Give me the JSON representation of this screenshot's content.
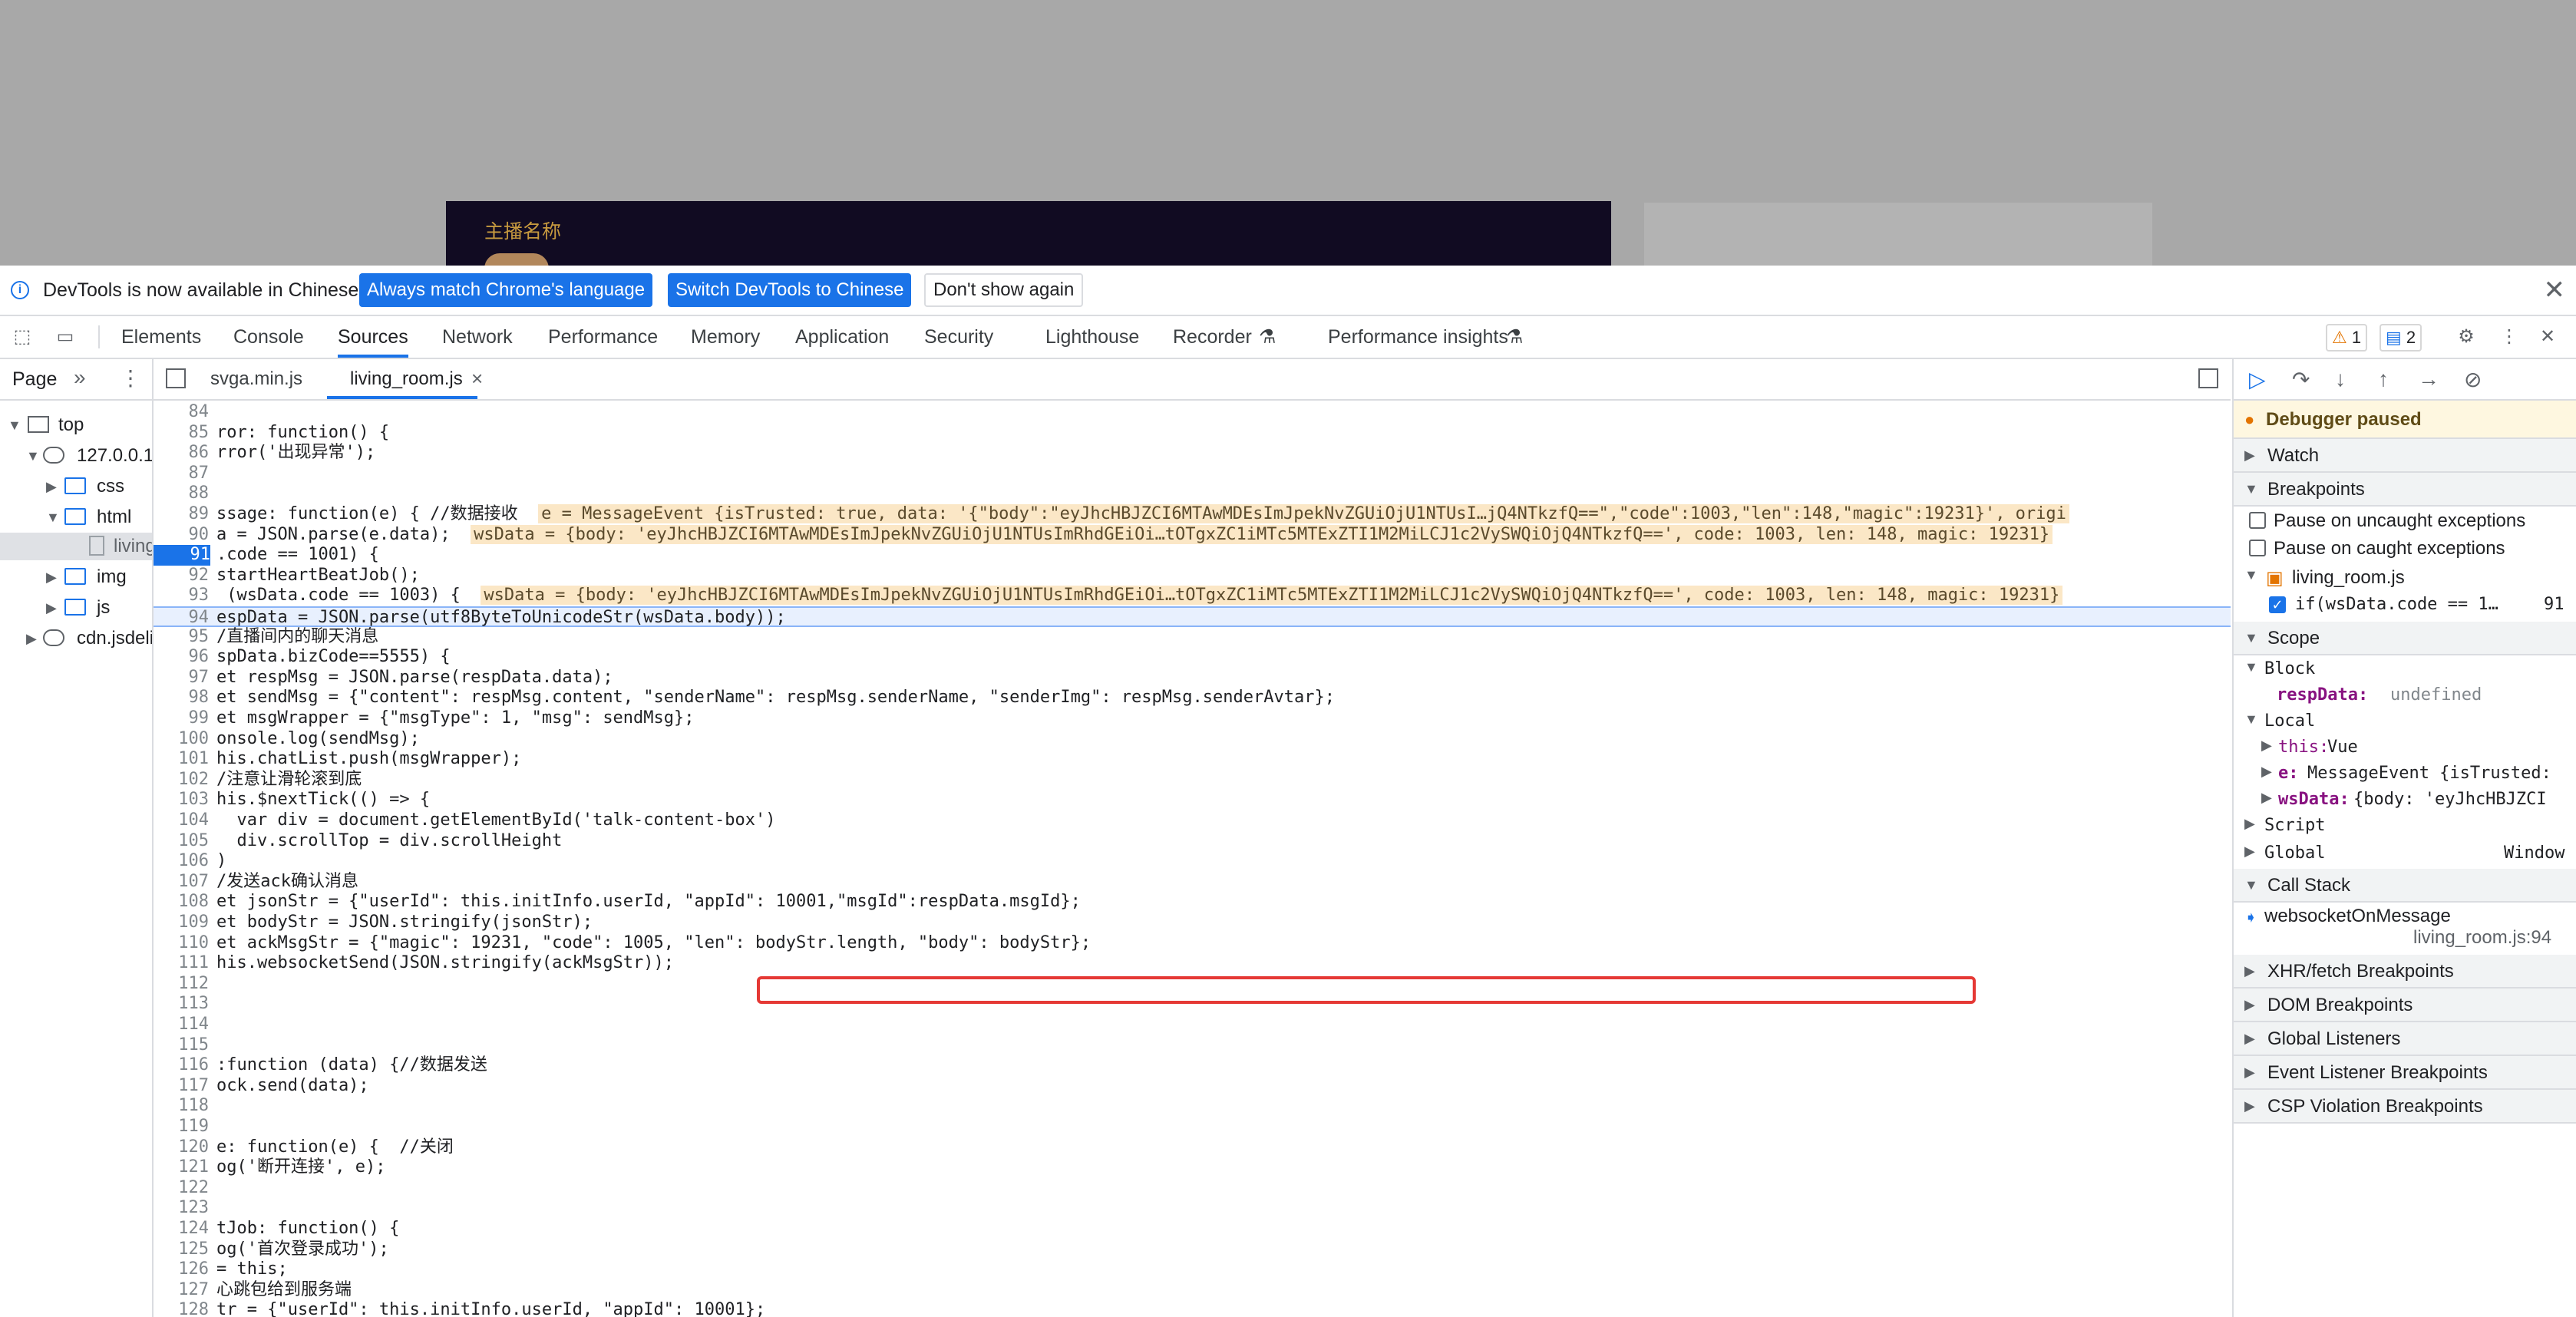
{
  "page": {
    "streamer_label": "主播名称"
  },
  "infobar": {
    "message": "DevTools is now available in Chinese!",
    "btn_match": "Always match Chrome's language",
    "btn_switch": "Switch DevTools to Chinese",
    "btn_dont_show": "Don't show again",
    "close": "✕"
  },
  "toolbar": {
    "tabs": [
      "Elements",
      "Console",
      "Sources",
      "Network",
      "Performance",
      "Memory",
      "Application",
      "Security",
      "Lighthouse",
      "Recorder",
      "Performance insights"
    ],
    "active_tab": "Sources",
    "warnings": "1",
    "issues": "2",
    "flask": "⚗"
  },
  "navigator": {
    "title": "Page",
    "tree": [
      "top",
      "127.0.0.1",
      "css",
      "html",
      "living_room.html",
      "img",
      "js",
      "cdn.jsdelivr.net"
    ]
  },
  "editor": {
    "tabs": [
      "svga.min.js",
      "living_room.js"
    ],
    "active_tab": "living_room.js"
  },
  "code": {
    "lines": [
      {
        "n": "84",
        "s": ""
      },
      {
        "n": "85",
        "s": "ror: function() {"
      },
      {
        "n": "86",
        "s": "rror('出现异常');"
      },
      {
        "n": "87",
        "s": ""
      },
      {
        "n": "88",
        "s": ""
      },
      {
        "n": "89",
        "s": "ssage: function(e) { //数据接收",
        "v": "e = MessageEvent {isTrusted: true, data: '{\"body\":\"eyJhcHBJZCI6MTAwMDEsImJpekNvZGUiOjU1NTUsI…jQ4NTkzfQ==\",\"code\":1003,\"len\":148,\"magic\":19231}', origi"
      },
      {
        "n": "90",
        "s": "a = JSON.parse(e.data);",
        "v": "wsData = {body: 'eyJhcHBJZCI6MTAwMDEsImJpekNvZGUiOjU1NTUsImRhdGEiOi…tOTgxZC1iMTc5MTExZTI1M2MiLCJ1c2VySWQiOjQ4NTkzfQ==', code: 1003, len: 148, magic: 19231}"
      },
      {
        "n": "91",
        "s": ".code == 1001) {"
      },
      {
        "n": "92",
        "s": "startHeartBeatJob();"
      },
      {
        "n": "93",
        "s": " (wsData.code == 1003) {",
        "v": "wsData = {body: 'eyJhcHBJZCI6MTAwMDEsImJpekNvZGUiOjU1NTUsImRhdGEiOi…tOTgxZC1iMTc5MTExZTI1M2MiLCJ1c2VySWQiOjQ4NTkzfQ==', code: 1003, len: 148, magic: 19231}"
      },
      {
        "n": "94",
        "s": "espData = JSON.parse(utf8ByteToUnicodeStr(wsData.body));"
      },
      {
        "n": "95",
        "s": "/直播间内的聊天消息"
      },
      {
        "n": "96",
        "s": "spData.bizCode==5555) {"
      },
      {
        "n": "97",
        "s": "et respMsg = JSON.parse(respData.data);"
      },
      {
        "n": "98",
        "s": "et sendMsg = {\"content\": respMsg.content, \"senderName\": respMsg.senderName, \"senderImg\": respMsg.senderAvtar};"
      },
      {
        "n": "99",
        "s": "et msgWrapper = {\"msgType\": 1, \"msg\": sendMsg};"
      },
      {
        "n": "100",
        "s": "onsole.log(sendMsg);"
      },
      {
        "n": "101",
        "s": "his.chatList.push(msgWrapper);"
      },
      {
        "n": "102",
        "s": "/注意让滑轮滚到底"
      },
      {
        "n": "103",
        "s": "his.$nextTick(() => {"
      },
      {
        "n": "104",
        "s": "  var div = document.getElementById('talk-content-box')"
      },
      {
        "n": "105",
        "s": "  div.scrollTop = div.scrollHeight"
      },
      {
        "n": "106",
        "s": ")"
      },
      {
        "n": "107",
        "s": "/发送ack确认消息"
      },
      {
        "n": "108",
        "s": "et jsonStr = {\"userId\": this.initInfo.userId, \"appId\": 10001,\"msgId\":respData.msgId};"
      },
      {
        "n": "109",
        "s": "et bodyStr = JSON.stringify(jsonStr);"
      },
      {
        "n": "110",
        "s": "et ackMsgStr = {\"magic\": 19231, \"code\": 1005, \"len\": bodyStr.length, \"body\": bodyStr};"
      },
      {
        "n": "111",
        "s": "his.websocketSend(JSON.stringify(ackMsgStr));"
      },
      {
        "n": "112",
        "s": ""
      },
      {
        "n": "113",
        "s": ""
      },
      {
        "n": "114",
        "s": ""
      },
      {
        "n": "115",
        "s": ""
      },
      {
        "n": "116",
        "s": ":function (data) {//数据发送"
      },
      {
        "n": "117",
        "s": "ock.send(data);"
      },
      {
        "n": "118",
        "s": ""
      },
      {
        "n": "119",
        "s": ""
      },
      {
        "n": "120",
        "s": "e: function(e) {  //关闭"
      },
      {
        "n": "121",
        "s": "og('断开连接', e);"
      },
      {
        "n": "122",
        "s": ""
      },
      {
        "n": "123",
        "s": ""
      },
      {
        "n": "124",
        "s": "tJob: function() {"
      },
      {
        "n": "125",
        "s": "og('首次登录成功');"
      },
      {
        "n": "126",
        "s": "= this;"
      },
      {
        "n": "127",
        "s": "心跳包给到服务端"
      },
      {
        "n": "128",
        "s": "tr = {\"userId\": this.initInfo.userId, \"appId\": 10001};"
      }
    ]
  },
  "sidebar": {
    "paused": "Debugger paused",
    "watch": "Watch",
    "breakpoints": "Breakpoints",
    "pause_uncaught": "Pause on uncaught exceptions",
    "pause_caught": "Pause on caught exceptions",
    "bp_file": "living_room.js",
    "bp_code": "if(wsData.code == 1…",
    "bp_line": "91",
    "scope": "Scope",
    "block": "Block",
    "resp_key": "respData:",
    "resp_val": "undefined",
    "local": "Local",
    "this_key": "this:",
    "this_val": "Vue",
    "e_key": "e:",
    "e_val": "MessageEvent {isTrusted:",
    "ws_key": "wsData:",
    "ws_val": "{body: 'eyJhcHBJZCI",
    "script": "Script",
    "global": "Global",
    "global_val": "Window",
    "call_stack": "Call Stack",
    "frame_fn": "websocketOnMessage",
    "frame_loc": "living_room.js:94",
    "xhr": "XHR/fetch Breakpoints",
    "dom": "DOM Breakpoints",
    "listeners": "Global Listeners",
    "event": "Event Listener Breakpoints",
    "csp": "CSP Violation Breakpoints"
  },
  "colors": {
    "accent": "#1a73e8",
    "highlight": "#e53935",
    "inline_value_bg": "#fbe7c6"
  }
}
